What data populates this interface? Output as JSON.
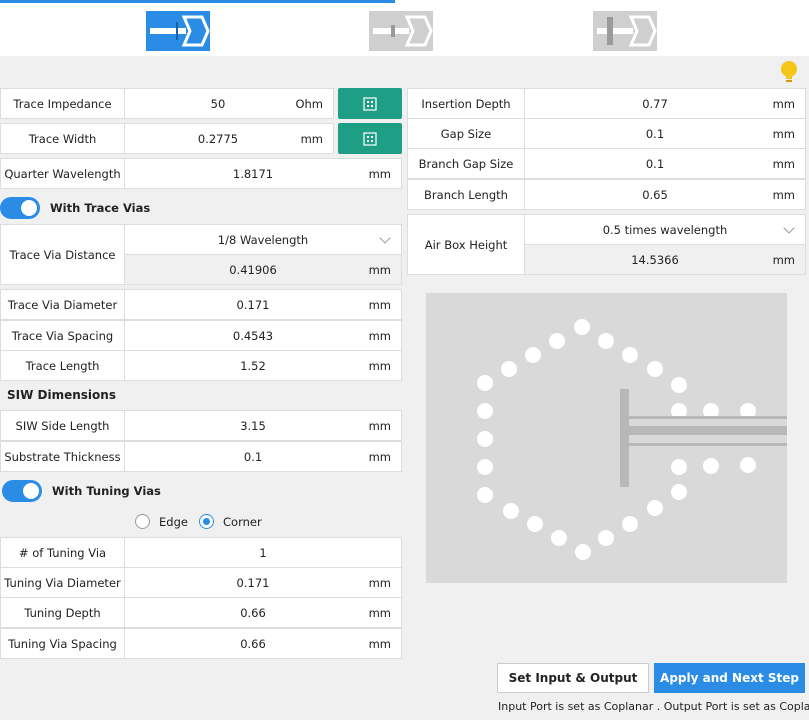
{
  "tabs": [
    {
      "name": "siw-port-tab",
      "active": true
    },
    {
      "name": "coaxial-port-tab",
      "active": false
    },
    {
      "name": "waveguide-port-tab",
      "active": false
    }
  ],
  "colors": {
    "accent": "#2b8ce6",
    "calc": "#1e9e85",
    "bulb": "#f5c518"
  },
  "trace": {
    "impedance": {
      "label": "Trace Impedance",
      "value": "50",
      "unit": "Ohm"
    },
    "width": {
      "label": "Trace Width",
      "value": "0.2775",
      "unit": "mm"
    },
    "quarter_wavelength": {
      "label": "Quarter Wavelength",
      "value": "1.8171",
      "unit": "mm"
    }
  },
  "trace_vias": {
    "toggle_label": "With Trace Vias",
    "distance_label": "Trace Via Distance",
    "distance_option": "1/8 Wavelength",
    "distance_value": "0.41906",
    "distance_unit": "mm",
    "diameter": {
      "label": "Trace Via Diameter",
      "value": "0.171",
      "unit": "mm"
    },
    "spacing": {
      "label": "Trace Via Spacing",
      "value": "0.4543",
      "unit": "mm"
    },
    "length": {
      "label": "Trace Length",
      "value": "1.52",
      "unit": "mm"
    }
  },
  "siw": {
    "title": "SIW Dimensions",
    "side_length": {
      "label": "SIW Side Length",
      "value": "3.15",
      "unit": "mm"
    },
    "substrate_thickness": {
      "label": "Substrate Thickness",
      "value": "0.1",
      "unit": "mm"
    }
  },
  "tuning": {
    "toggle_label": "With Tuning Vias",
    "option_edge": "Edge",
    "option_corner": "Corner",
    "selected": "Corner",
    "count": {
      "label": "# of Tuning Via",
      "value": "1"
    },
    "diameter": {
      "label": "Tuning Via Diameter",
      "value": "0.171",
      "unit": "mm"
    },
    "depth": {
      "label": "Tuning Depth",
      "value": "0.66",
      "unit": "mm"
    },
    "spacing": {
      "label": "Tuning Via Spacing",
      "value": "0.66",
      "unit": "mm"
    }
  },
  "right": {
    "insertion_depth": {
      "label": "Insertion Depth",
      "value": "0.77",
      "unit": "mm"
    },
    "gap_size": {
      "label": "Gap Size",
      "value": "0.1",
      "unit": "mm"
    },
    "branch_gap_size": {
      "label": "Branch Gap Size",
      "value": "0.1",
      "unit": "mm"
    },
    "branch_length": {
      "label": "Branch Length",
      "value": "0.65",
      "unit": "mm"
    },
    "air_box": {
      "label": "Air Box Height",
      "option": "0.5 times wavelength",
      "value": "14.5366",
      "unit": "mm"
    }
  },
  "buttons": {
    "set_io": "Set Input & Output",
    "apply": "Apply and Next Step"
  },
  "footer": "Input Port is set as Coplanar .  Output Port is set as Coplanar ."
}
